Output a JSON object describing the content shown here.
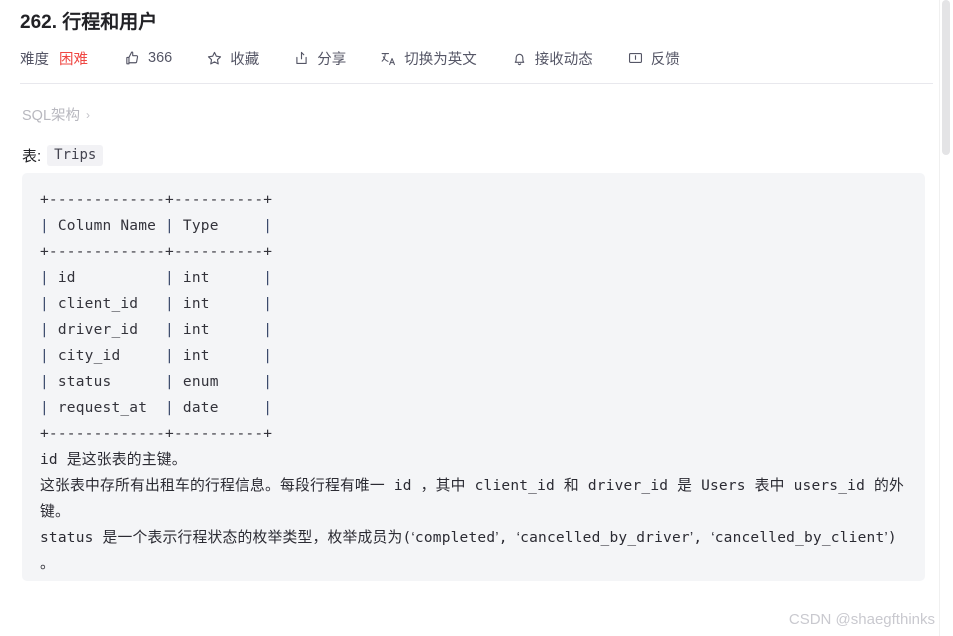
{
  "header": {
    "title": "262. 行程和用户",
    "difficulty_label": "难度",
    "difficulty_value": "困难",
    "likes_count": "366",
    "favorite_label": "收藏",
    "share_label": "分享",
    "translate_label": "切换为英文",
    "subscribe_label": "接收动态",
    "feedback_label": "反馈"
  },
  "breadcrumb": {
    "label": "SQL架构",
    "chevron": "›"
  },
  "table_intro": {
    "label": "表:",
    "table_name": "Trips"
  },
  "code_block": {
    "lines": [
      "+-------------+----------+",
      "| Column Name | Type     |",
      "+-------------+----------+",
      "| id          | int      |",
      "| client_id   | int      |",
      "| driver_id   | int      |",
      "| city_id     | int      |",
      "| status      | enum     |",
      "| request_at  | date     |",
      "+-------------+----------+"
    ],
    "schema": {
      "columns": [
        "Column Name",
        "Type"
      ],
      "rows": [
        [
          "id",
          "int"
        ],
        [
          "client_id",
          "int"
        ],
        [
          "driver_id",
          "int"
        ],
        [
          "city_id",
          "int"
        ],
        [
          "status",
          "enum"
        ],
        [
          "request_at",
          "date"
        ]
      ]
    },
    "description": [
      "id 是这张表的主键。",
      "这张表中存所有出租车的行程信息。每段行程有唯一 id ，其中 client_id 和 driver_id 是 Users 表中 users_id 的外键。",
      "status 是一个表示行程状态的枚举类型，枚举成员为(‘completed’, ‘cancelled_by_driver’, ‘cancelled_by_client’) 。"
    ]
  },
  "watermark": "CSDN @shaegfthinks",
  "colors": {
    "difficulty": "#ef4743",
    "code_bg": "#f4f5f7",
    "text": "#222226",
    "muted": "#555666",
    "breadcrumb": "#b8b8bf",
    "watermark": "#c9c9cf"
  }
}
